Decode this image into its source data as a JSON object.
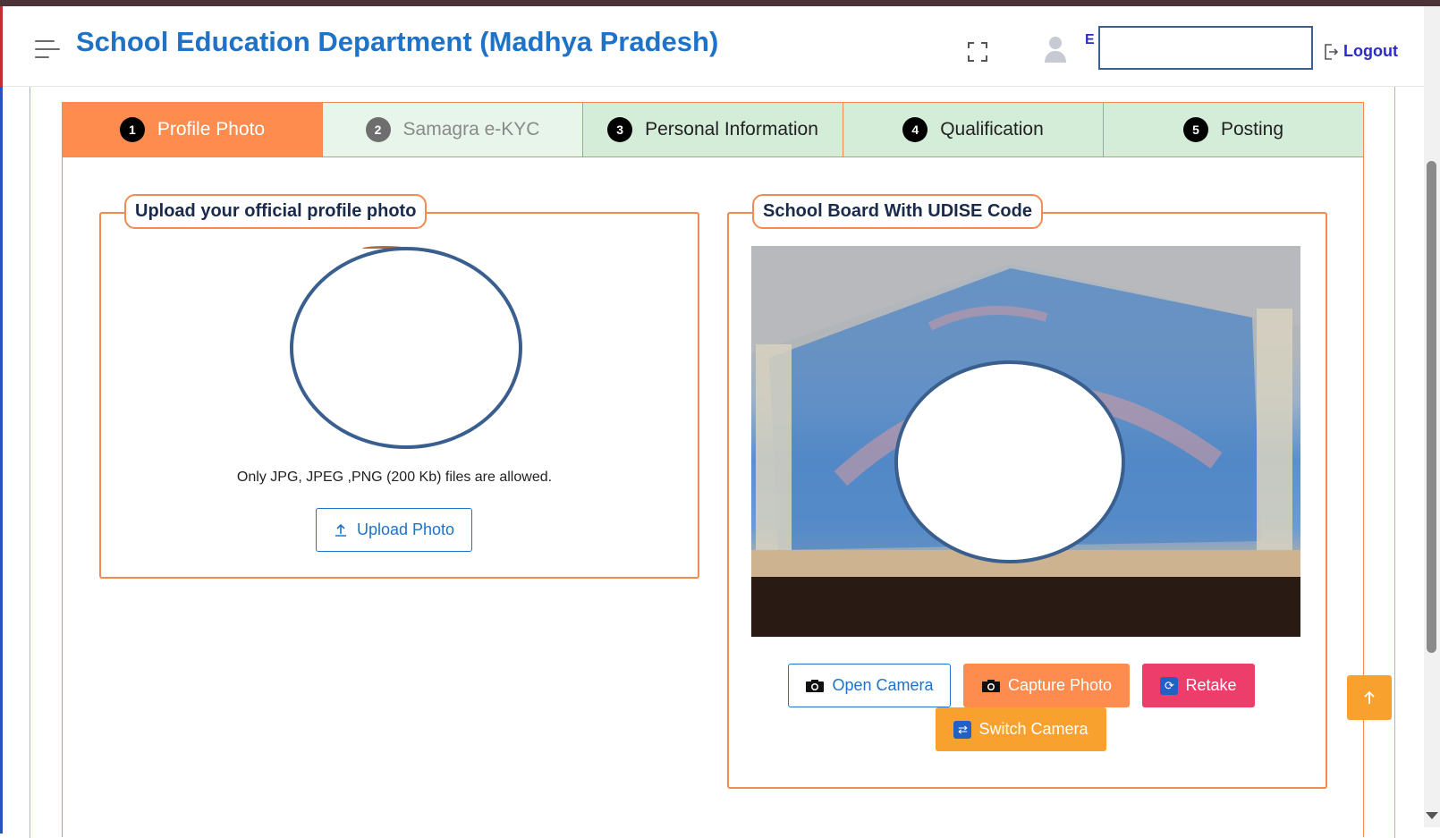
{
  "header": {
    "title": "School Education Department (Madhya Pradesh)",
    "user_initial": "E",
    "logout_label": "Logout",
    "icons": [
      "menu-icon",
      "fullscreen-icon",
      "user-icon",
      "logout-icon"
    ]
  },
  "steps": [
    {
      "num": "1",
      "label": "Profile Photo",
      "state": "active"
    },
    {
      "num": "2",
      "label": "Samagra e-KYC",
      "state": "muted"
    },
    {
      "num": "3",
      "label": "Personal Information",
      "state": "pending"
    },
    {
      "num": "4",
      "label": "Qualification",
      "state": "pending"
    },
    {
      "num": "5",
      "label": "Posting",
      "state": "pending"
    }
  ],
  "profile_panel": {
    "title": "Upload your official profile photo",
    "hint": "Only JPG, JPEG ,PNG (200 Kb) files are allowed.",
    "upload_label": "Upload Photo"
  },
  "board_panel": {
    "title": "School Board With UDISE Code",
    "open_camera_label": "Open Camera",
    "capture_label": "Capture Photo",
    "retake_label": "Retake",
    "switch_label": "Switch Camera"
  },
  "colors": {
    "accent_blue": "#1e73c8",
    "active_step": "#ff8c4f",
    "pending_step": "#d4edd9",
    "retake": "#ec3d6b",
    "switch": "#f9a12e"
  }
}
